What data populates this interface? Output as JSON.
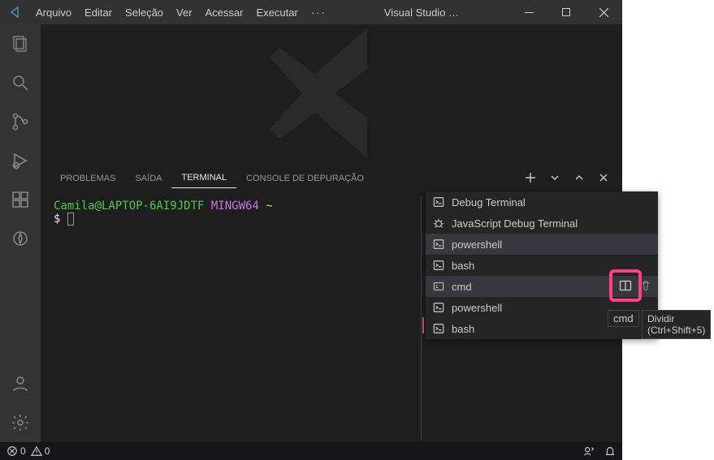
{
  "title": "Visual Studio …",
  "menu": [
    "Arquivo",
    "Editar",
    "Seleção",
    "Ver",
    "Acessar",
    "Executar"
  ],
  "panel": {
    "tabs": [
      "PROBLEMAS",
      "SAÍDA",
      "TERMINAL",
      "CONSOLE DE DEPURAÇÃO"
    ],
    "active": "TERMINAL"
  },
  "terminal": {
    "user_host": "Camila@LAPTOP-6AI9JDTF",
    "shell": "MINGW64",
    "path": "~",
    "prompt": "$"
  },
  "dropdown": [
    {
      "label": "Debug Terminal",
      "icon": "term"
    },
    {
      "label": "JavaScript Debug Terminal",
      "icon": "bug"
    },
    {
      "label": "powershell",
      "icon": "term",
      "hovered": true
    },
    {
      "label": "bash",
      "icon": "term"
    },
    {
      "label": "cmd",
      "icon": "cmd",
      "hovered": true,
      "actions": true
    },
    {
      "label": "powershell",
      "icon": "term"
    },
    {
      "label": "bash",
      "icon": "term"
    }
  ],
  "cmd_tag": "cmd",
  "tooltip": "Dividir (Ctrl+Shift+5)",
  "status": {
    "errors": "0",
    "warnings": "0"
  }
}
